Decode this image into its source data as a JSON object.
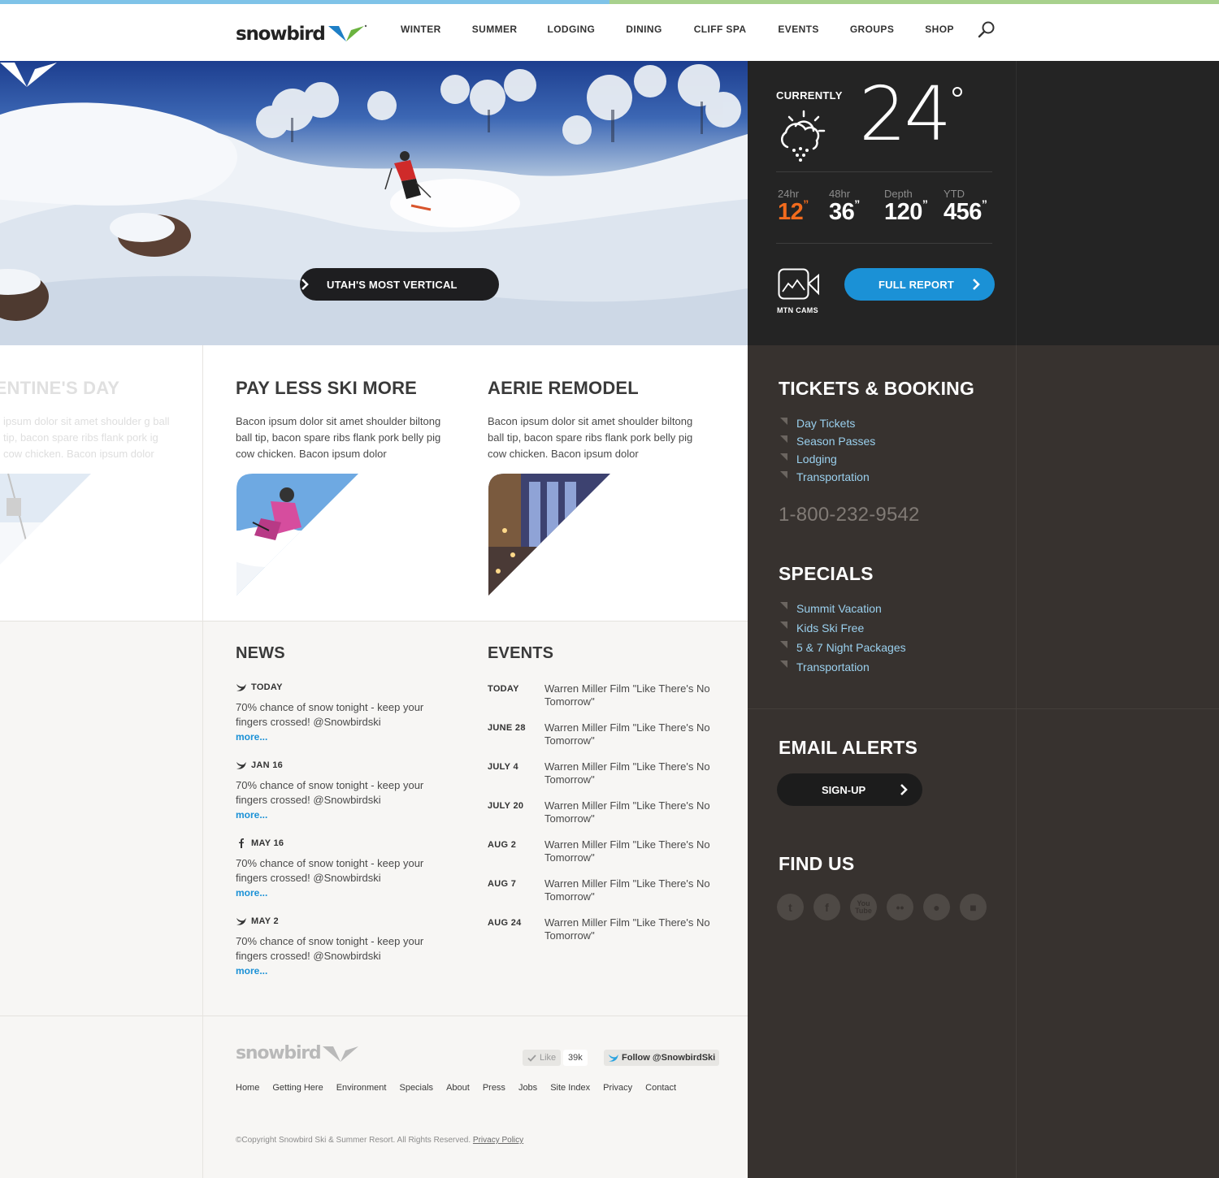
{
  "colors": {
    "accent_blue": "#7fc3e8",
    "accent_green": "#a8d18d",
    "link_blue": "#1b91d6",
    "orange": "#f26b1d",
    "dark": "#242424",
    "sidebar": "#37322f"
  },
  "header": {
    "logo": "snowbird",
    "nav": [
      "WINTER",
      "SUMMER",
      "LODGING",
      "DINING",
      "CLIFF SPA",
      "EVENTS",
      "GROUPS",
      "SHOP"
    ],
    "search_icon": "search-icon"
  },
  "hero": {
    "cta": "UTAH'S MOST VERTICAL"
  },
  "weather": {
    "currently": "CURRENTLY",
    "temp": "24",
    "icon": "partly-cloudy-snow-icon",
    "stats": [
      {
        "label": "24hr",
        "value": "12"
      },
      {
        "label": "48hr",
        "value": "36"
      },
      {
        "label": "Depth",
        "value": "120"
      },
      {
        "label": "YTD",
        "value": "456"
      }
    ],
    "cams_label": "MTN CAMS",
    "full_report": "FULL REPORT"
  },
  "promos": [
    {
      "title": "LENTINE'S DAY",
      "body": "ipsum dolor sit amet shoulder g ball tip, bacon spare ribs flank pork ig cow chicken. Bacon ipsum dolor"
    },
    {
      "title": "PAY LESS SKI MORE",
      "body": "Bacon ipsum dolor sit amet shoulder biltong ball tip, bacon spare ribs flank pork belly pig cow chicken. Bacon ipsum dolor"
    },
    {
      "title": "AERIE REMODEL",
      "body": "Bacon ipsum dolor sit amet shoulder biltong ball tip, bacon spare ribs flank pork belly pig cow chicken. Bacon ipsum dolor"
    }
  ],
  "news": {
    "title": "NEWS",
    "more": "more...",
    "items": [
      {
        "source": "twitter",
        "date": "TODAY",
        "text": "70% chance of snow tonight - keep your fingers crossed! @Snowbirdski"
      },
      {
        "source": "twitter",
        "date": "JAN 16",
        "text": "70% chance of snow tonight - keep your fingers crossed! @Snowbirdski"
      },
      {
        "source": "facebook",
        "date": "MAY 16",
        "text": "70% chance of snow tonight - keep your fingers crossed! @Snowbirdski"
      },
      {
        "source": "twitter",
        "date": "MAY 2",
        "text": "70% chance of snow tonight - keep your fingers crossed! @Snowbirdski"
      }
    ]
  },
  "events": {
    "title": "EVENTS",
    "items": [
      {
        "date": "TODAY",
        "text": "Warren Miller Film \"Like There's No Tomorrow\""
      },
      {
        "date": "JUNE 28",
        "text": "Warren Miller Film \"Like There's No Tomorrow\""
      },
      {
        "date": "JULY 4",
        "text": "Warren Miller Film \"Like There's No Tomorrow\""
      },
      {
        "date": "JULY 20",
        "text": "Warren Miller Film \"Like There's No Tomorrow\""
      },
      {
        "date": "AUG 2",
        "text": "Warren Miller Film \"Like There's No Tomorrow\""
      },
      {
        "date": "AUG 7",
        "text": "Warren Miller Film \"Like There's No Tomorrow\""
      },
      {
        "date": "AUG 24",
        "text": "Warren Miller Film \"Like There's No Tomorrow\""
      }
    ]
  },
  "sidebar": {
    "tickets_title": "TICKETS & BOOKING",
    "tickets": [
      "Day Tickets",
      "Season Passes",
      "Lodging",
      "Transportation"
    ],
    "phone": "1-800-232-9542",
    "specials_title": "SPECIALS",
    "specials": [
      "Summit Vacation",
      "Kids Ski Free",
      "5 & 7 Night Packages",
      "Transportation"
    ],
    "email_title": "EMAIL ALERTS",
    "signup": "SIGN-UP",
    "find_title": "FIND US",
    "social": [
      "twitter-icon",
      "facebook-icon",
      "youtube-icon",
      "flickr-icon",
      "apple-icon",
      "android-icon"
    ]
  },
  "footer": {
    "logo": "snowbird",
    "like": "Like",
    "like_count": "39k",
    "follow": "Follow @SnowbirdSki",
    "links": [
      "Home",
      "Getting Here",
      "Environment",
      "Specials",
      "About",
      "Press",
      "Jobs",
      "Site Index",
      "Privacy",
      "Contact"
    ],
    "copyright": "©Copyright Snowbird Ski & Summer Resort. All Rights Reserved.",
    "privacy": "Privacy Policy"
  }
}
